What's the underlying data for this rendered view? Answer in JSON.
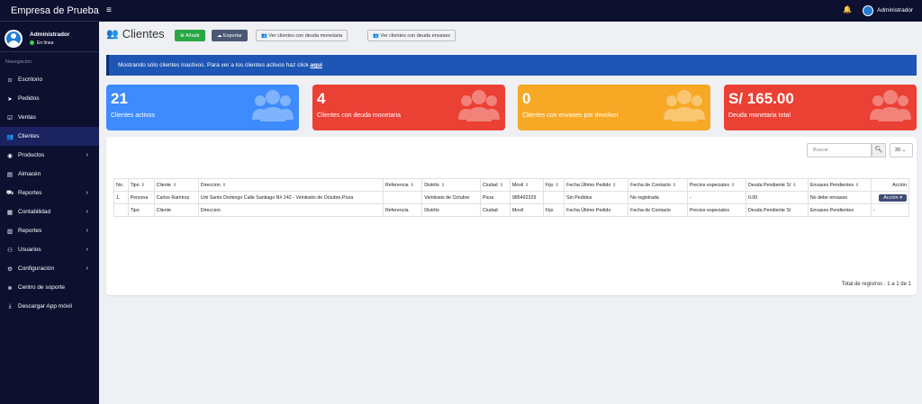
{
  "sidebar": {
    "brand": "Empresa de Prueba",
    "user": {
      "name": "Administrador",
      "status": "En línea"
    },
    "nav_header": "Navegación",
    "items": [
      {
        "label": "Escritorio",
        "icon": "tachometer-icon",
        "glyph": "⊙",
        "chevron": ""
      },
      {
        "label": "Pedidos",
        "icon": "paper-plane-icon",
        "glyph": "➤",
        "chevron": ""
      },
      {
        "label": "Ventas",
        "icon": "check-square-icon",
        "glyph": "☑",
        "chevron": ""
      },
      {
        "label": "Clientes",
        "icon": "users-icon",
        "glyph": "👥",
        "chevron": "",
        "active": true
      },
      {
        "label": "Productos",
        "icon": "box-icon",
        "glyph": "◉",
        "chevron": "›"
      },
      {
        "label": "Almacén",
        "icon": "warehouse-icon",
        "glyph": "▤",
        "chevron": ""
      },
      {
        "label": "Reportes",
        "icon": "truck-icon",
        "glyph": "⛟",
        "chevron": "›"
      },
      {
        "label": "Contabilidad",
        "icon": "calculator-icon",
        "glyph": "▦",
        "chevron": "›"
      },
      {
        "label": "Reportes",
        "icon": "chart-icon",
        "glyph": "▥",
        "chevron": "›"
      },
      {
        "label": "Usuarios",
        "icon": "user-group-icon",
        "glyph": "⚇",
        "chevron": "›"
      },
      {
        "label": "Configuración",
        "icon": "cogs-icon",
        "glyph": "⚙",
        "chevron": "›"
      },
      {
        "label": "Centro de soporte",
        "icon": "lifebuoy-icon",
        "glyph": "⊗",
        "chevron": ""
      },
      {
        "label": "Descargar App móvil",
        "icon": "download-icon",
        "glyph": "⤓",
        "chevron": ""
      }
    ]
  },
  "topbar": {
    "hamburger": "≡",
    "bell": "🔔",
    "user": "Administrador"
  },
  "page": {
    "title": "Clientes",
    "buttons": {
      "add": "Añadir",
      "export": "Exportar",
      "debt_money": "Ver clientes con deuda monetaria",
      "debt_containers": "Ver clientes con deuda envases"
    }
  },
  "alert": {
    "text": "Mostrando sólo clientes inactivos. Para ver a los clientes activos haz click ",
    "link": "aquí"
  },
  "cards": [
    {
      "value": "21",
      "label": "Clientes activos",
      "color": "#3d8bfd"
    },
    {
      "value": "4",
      "label": "Clientes con deuda monetaria",
      "color": "#eb4034"
    },
    {
      "value": "0",
      "label": "Clientes con envases por devolver",
      "color": "#f7a825"
    },
    {
      "value": "S/ 165.00",
      "label": "Deuda monetaria total",
      "color": "#eb4034"
    }
  ],
  "table": {
    "search_placeholder": "Buscar",
    "page_size": "20",
    "headers": [
      "No.",
      "Tipo",
      "Cliente",
      "Direccion",
      "Referencia",
      "Distrito",
      "Ciudad",
      "Movil",
      "Fijo",
      "Fecha Último Pedido",
      "Fecha de Contacto",
      "Precios especiales",
      "Deuda Pendiente S/",
      "Envases Pendientes",
      "Acción"
    ],
    "sortable": [
      false,
      true,
      true,
      true,
      true,
      true,
      true,
      true,
      true,
      true,
      true,
      true,
      true,
      true,
      false
    ],
    "rows": [
      [
        "1.",
        "Persona",
        "Carlos Ramírez",
        "Urb Santo Domingo Calle Santiago N# 242 - Veintiséis de Octubre,Piura",
        "",
        "Veintiseis de Octubre",
        "Piura",
        "985492329",
        "",
        "Sin Pedidos",
        "No registrada",
        "-",
        "0.00",
        "No debe envases",
        "Acción ▾"
      ]
    ],
    "footer": [
      "",
      "Tipo",
      "Cliente",
      "Direccion",
      "Referencia",
      "Distrito",
      "Ciudad",
      "Movil",
      "Fijo",
      "Fecha Último Pedido",
      "Fecha de Contacto",
      "Precios especiales",
      "Deuda Pendiente S/",
      "Envases Pendientes",
      "-"
    ],
    "total": "Total de registros : 1 a 1 de 1"
  }
}
